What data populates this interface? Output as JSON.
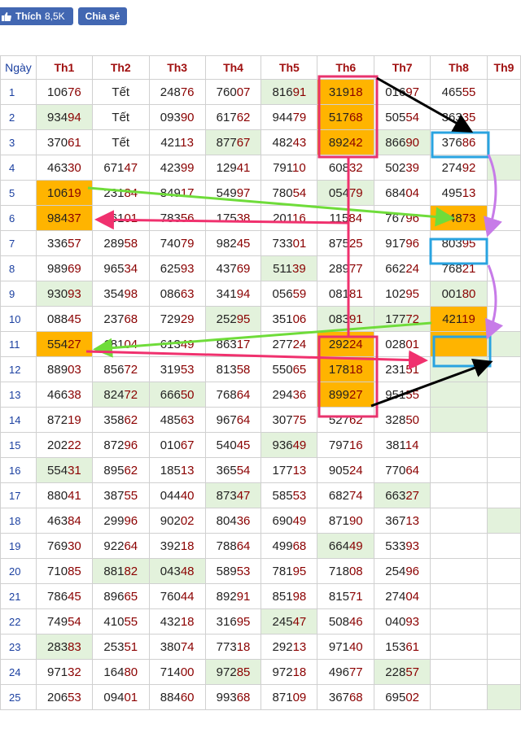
{
  "social": {
    "like_label": "Thích",
    "like_count": "8,5K",
    "share_label": "Chia sẻ"
  },
  "table": {
    "headers": [
      "Ngày",
      "Th1",
      "Th2",
      "Th3",
      "Th4",
      "Th5",
      "Th6",
      "Th7",
      "Th8",
      "Th9"
    ],
    "rows": [
      [
        "1",
        "10676",
        "Tết",
        "24876",
        "76007",
        "81691",
        "31918",
        "01697",
        "46555",
        ""
      ],
      [
        "2",
        "93494",
        "Tết",
        "09390",
        "61762",
        "94479",
        "51768",
        "50554",
        "36335",
        ""
      ],
      [
        "3",
        "37061",
        "Tết",
        "42113",
        "87767",
        "48243",
        "89242",
        "86690",
        "37686",
        ""
      ],
      [
        "4",
        "46330",
        "67147",
        "42399",
        "12941",
        "79110",
        "60832",
        "50239",
        "27492",
        ""
      ],
      [
        "5",
        "10619",
        "23184",
        "84917",
        "54997",
        "78054",
        "05479",
        "68404",
        "49513",
        ""
      ],
      [
        "6",
        "98437",
        "16101",
        "78356",
        "17538",
        "20116",
        "11584",
        "76796",
        "74873",
        ""
      ],
      [
        "7",
        "33657",
        "28958",
        "74079",
        "98245",
        "73301",
        "87525",
        "91796",
        "80395",
        ""
      ],
      [
        "8",
        "98969",
        "96534",
        "62593",
        "43769",
        "51139",
        "28977",
        "66224",
        "76821",
        ""
      ],
      [
        "9",
        "93093",
        "35498",
        "08663",
        "34194",
        "05659",
        "08181",
        "10295",
        "00180",
        ""
      ],
      [
        "10",
        "08845",
        "23768",
        "72929",
        "25295",
        "35106",
        "08391",
        "17772",
        "42119",
        ""
      ],
      [
        "11",
        "55427",
        "18104",
        "61349",
        "86317",
        "27724",
        "29224",
        "02801",
        "",
        ""
      ],
      [
        "12",
        "88903",
        "85672",
        "31953",
        "81358",
        "55065",
        "17818",
        "23151",
        "",
        ""
      ],
      [
        "13",
        "46638",
        "82472",
        "66650",
        "76864",
        "29436",
        "89927",
        "95155",
        "",
        ""
      ],
      [
        "14",
        "87219",
        "35862",
        "48563",
        "96764",
        "30775",
        "52762",
        "32850",
        "",
        ""
      ],
      [
        "15",
        "20222",
        "87296",
        "01067",
        "54045",
        "93649",
        "79716",
        "38114",
        "",
        ""
      ],
      [
        "16",
        "55431",
        "89562",
        "18513",
        "36554",
        "17713",
        "90524",
        "77064",
        "",
        ""
      ],
      [
        "17",
        "88041",
        "38755",
        "04440",
        "87347",
        "58553",
        "68274",
        "66327",
        "",
        ""
      ],
      [
        "18",
        "46384",
        "29996",
        "90202",
        "80436",
        "69049",
        "87190",
        "36713",
        "",
        ""
      ],
      [
        "19",
        "76930",
        "92264",
        "39218",
        "78864",
        "49968",
        "66449",
        "53393",
        "",
        ""
      ],
      [
        "20",
        "71085",
        "88182",
        "04348",
        "58953",
        "78195",
        "71808",
        "25496",
        "",
        ""
      ],
      [
        "21",
        "78645",
        "89665",
        "76044",
        "89291",
        "85198",
        "81571",
        "27404",
        "",
        ""
      ],
      [
        "22",
        "74954",
        "41055",
        "43218",
        "31695",
        "24547",
        "50846",
        "04093",
        "",
        ""
      ],
      [
        "23",
        "28383",
        "25351",
        "38074",
        "77318",
        "29213",
        "97140",
        "15361",
        "",
        ""
      ],
      [
        "24",
        "97132",
        "16480",
        "71400",
        "97285",
        "97218",
        "49677",
        "22857",
        "",
        ""
      ],
      [
        "25",
        "20653",
        "09401",
        "88460",
        "99368",
        "87109",
        "36768",
        "69502",
        "",
        ""
      ]
    ]
  },
  "colors": {
    "highlight_orange": "#ffb400",
    "highlight_green": "#e3f2dc",
    "tail_red": "#8b0000",
    "box_pink": "#e8336d",
    "box_blue": "#29a3e0",
    "arrow_black": "#000000",
    "arrow_green": "#6fdc3a",
    "arrow_pink": "#f0316e",
    "arrow_purple": "#c77be8"
  }
}
